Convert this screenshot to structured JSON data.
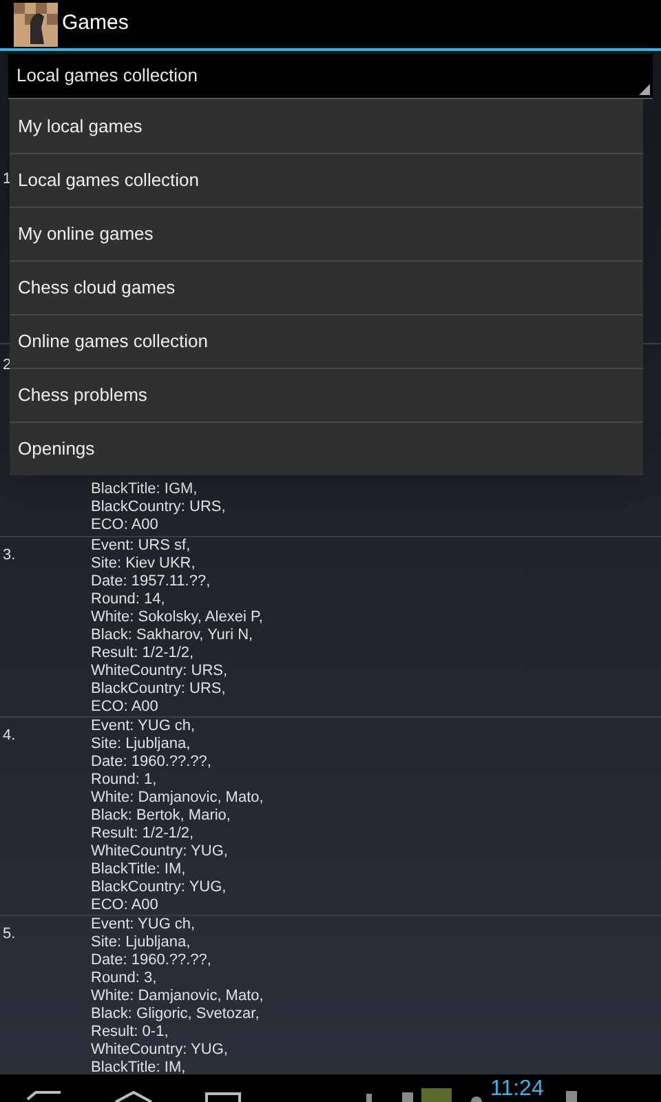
{
  "action_bar": {
    "title": "Games"
  },
  "spinner": {
    "value": "Local games collection"
  },
  "dropdown": {
    "items": [
      {
        "label": "My local games"
      },
      {
        "label": "Local games collection"
      },
      {
        "label": "My online games"
      },
      {
        "label": "Chess cloud games"
      },
      {
        "label": "Online games collection"
      },
      {
        "label": "Chess problems"
      },
      {
        "label": "Openings"
      }
    ]
  },
  "games": [
    {
      "number": "1"
    },
    {
      "number": "2",
      "lines": [
        "BlackTitle: IGM,",
        "BlackCountry: URS,",
        "ECO: A00"
      ]
    },
    {
      "number": "3.",
      "lines": [
        "Event: URS sf,",
        "Site: Kiev UKR,",
        "Date: 1957.11.??,",
        "Round: 14,",
        "White: Sokolsky, Alexei P,",
        "Black: Sakharov, Yuri N,",
        "Result: 1/2-1/2,",
        "WhiteCountry: URS,",
        "BlackCountry: URS,",
        "ECO: A00"
      ]
    },
    {
      "number": "4.",
      "lines": [
        "Event: YUG ch,",
        "Site: Ljubljana,",
        "Date: 1960.??.??,",
        "Round: 1,",
        "White: Damjanovic, Mato,",
        "Black: Bertok, Mario,",
        "Result: 1/2-1/2,",
        "WhiteCountry: YUG,",
        "BlackTitle: IM,",
        "BlackCountry: YUG,",
        "ECO: A00"
      ]
    },
    {
      "number": "5.",
      "lines": [
        "Event: YUG ch,",
        "Site: Ljubljana,",
        "Date: 1960.??.??,",
        "Round: 3,",
        "White: Damjanovic, Mato,",
        "Black: Gligoric, Svetozar,",
        "Result: 0-1,",
        "WhiteCountry: YUG,",
        "BlackTitle: IM,"
      ]
    }
  ],
  "status": {
    "time": "11:24"
  }
}
